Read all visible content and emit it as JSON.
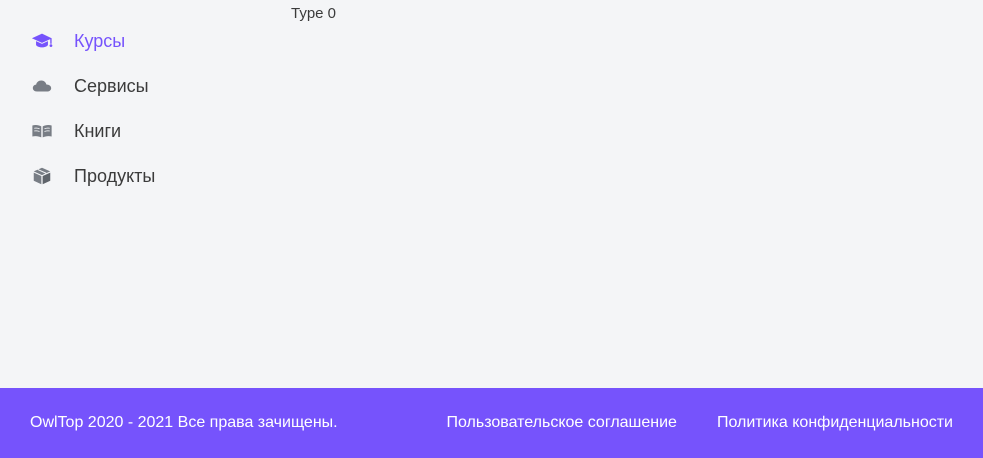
{
  "sidebar": {
    "items": [
      {
        "label": "Курсы",
        "icon": "graduation-cap-icon",
        "active": true
      },
      {
        "label": "Сервисы",
        "icon": "cloud-icon",
        "active": false
      },
      {
        "label": "Книги",
        "icon": "open-book-icon",
        "active": false
      },
      {
        "label": "Продукты",
        "icon": "box-icon",
        "active": false
      }
    ]
  },
  "main": {
    "type_text": "Type 0"
  },
  "footer": {
    "copyright": "OwlTop 2020 - 2021 Все права зачищены.",
    "links": [
      {
        "label": "Пользовательское соглашение"
      },
      {
        "label": "Политика конфиденциальности"
      }
    ]
  },
  "colors": {
    "accent": "#7653fc",
    "background": "#f4f5f7",
    "text": "#3b3b3b",
    "icon_inactive": "#787d85"
  }
}
